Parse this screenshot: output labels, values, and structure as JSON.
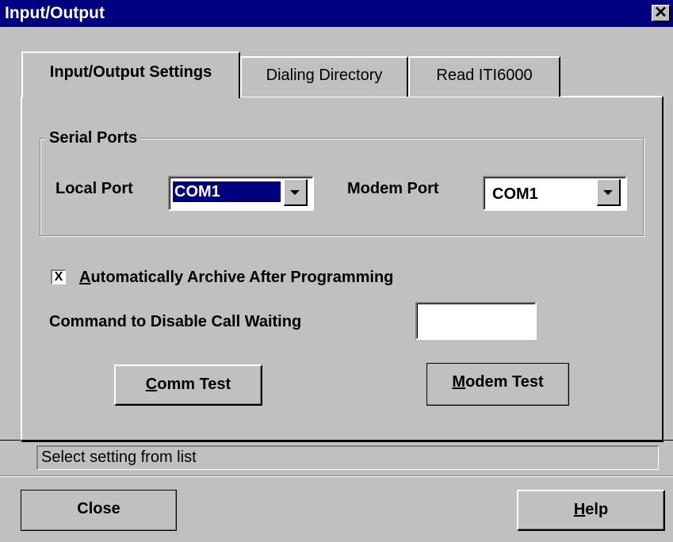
{
  "window": {
    "title": "Input/Output",
    "close_glyph": "✕"
  },
  "tabs": [
    {
      "label": "Input/Output Settings",
      "active": true
    },
    {
      "label": "Dialing Directory",
      "active": false
    },
    {
      "label": "Read ITI6000",
      "active": false
    }
  ],
  "serial_ports": {
    "group_label": "Serial Ports",
    "local_port_label": "Local Port",
    "local_port_value": "COM1",
    "modem_port_label": "Modem Port",
    "modem_port_value": "COM1"
  },
  "archive": {
    "checked": true,
    "check_mark": "X",
    "underline_char": "A",
    "label_rest": "utomatically Archive After Programming"
  },
  "call_waiting": {
    "label": "Command to Disable Call Waiting",
    "value": ""
  },
  "buttons": {
    "comm_test": {
      "accel": "C",
      "rest": "omm Test"
    },
    "modem_test": {
      "accel": "M",
      "rest": "odem Test"
    },
    "close": "Close",
    "help": {
      "accel": "H",
      "rest": "elp"
    }
  },
  "status_text": "Select setting from list",
  "icons": [
    "close-icon",
    "chevron-down-icon",
    "chevron-down-icon",
    "checkbox-icon"
  ],
  "colors": {
    "titlebar": "#000080",
    "face": "#c0c0c0",
    "selection": "#000080"
  }
}
